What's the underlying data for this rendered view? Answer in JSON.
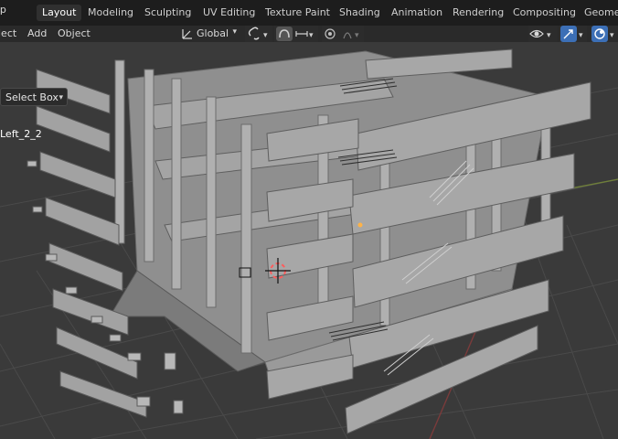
{
  "menubar": {
    "help_label": "elp",
    "tabs": [
      {
        "label": "Layout",
        "active": true
      },
      {
        "label": "Modeling"
      },
      {
        "label": "Sculpting"
      },
      {
        "label": "UV Editing"
      },
      {
        "label": "Texture Paint"
      },
      {
        "label": "Shading"
      },
      {
        "label": "Animation"
      },
      {
        "label": "Rendering"
      },
      {
        "label": "Compositing"
      },
      {
        "label": "Geomet"
      }
    ]
  },
  "toolbar": {
    "select_label": "lect",
    "add_label": "Add",
    "object_label": "Object",
    "transform_orientation": "Global"
  },
  "viewport": {
    "select_mode": "Select Box",
    "object_label": "Left_2_2"
  },
  "colors": {
    "topbar": "#1d1d1d",
    "toolbar": "#2a2a2a",
    "viewport_bg": "#3a3a3a",
    "accent_blue": "#3c6fb6",
    "model_grey": "#9c9c9c"
  }
}
